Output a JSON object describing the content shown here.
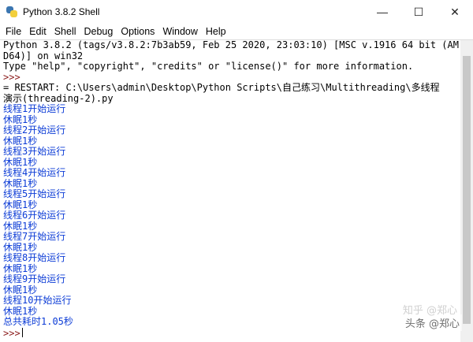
{
  "window": {
    "title": "Python 3.8.2 Shell",
    "controls": {
      "minimize": "—",
      "maximize": "☐",
      "close": "✕"
    }
  },
  "menu": [
    "File",
    "Edit",
    "Shell",
    "Debug",
    "Options",
    "Window",
    "Help"
  ],
  "shell": {
    "banner": [
      "Python 3.8.2 (tags/v3.8.2:7b3ab59, Feb 25 2020, 23:03:10) [MSC v.1916 64 bit (AM",
      "D64)] on win32",
      "Type \"help\", \"copyright\", \"credits\" or \"license()\" for more information."
    ],
    "prompt": ">>>",
    "restart": [
      "= RESTART: C:\\Users\\admin\\Desktop\\Python Scripts\\自己练习\\Multithreading\\多线程",
      "演示(threading-2).py"
    ],
    "output": [
      "线程1开始运行",
      "休眠1秒",
      "线程2开始运行",
      "休眠1秒",
      "线程3开始运行",
      "休眠1秒",
      "线程4开始运行",
      "休眠1秒",
      "线程5开始运行",
      "休眠1秒",
      "线程6开始运行",
      "休眠1秒",
      "线程7开始运行",
      "休眠1秒",
      "线程8开始运行",
      "休眠1秒",
      "线程9开始运行",
      "休眠1秒",
      "线程10开始运行",
      "休眠1秒",
      "总共耗时1.05秒"
    ],
    "final_prompt": ">>>"
  },
  "watermark": {
    "top": "知乎 @郑心",
    "bottom": "头条 @郑心"
  }
}
